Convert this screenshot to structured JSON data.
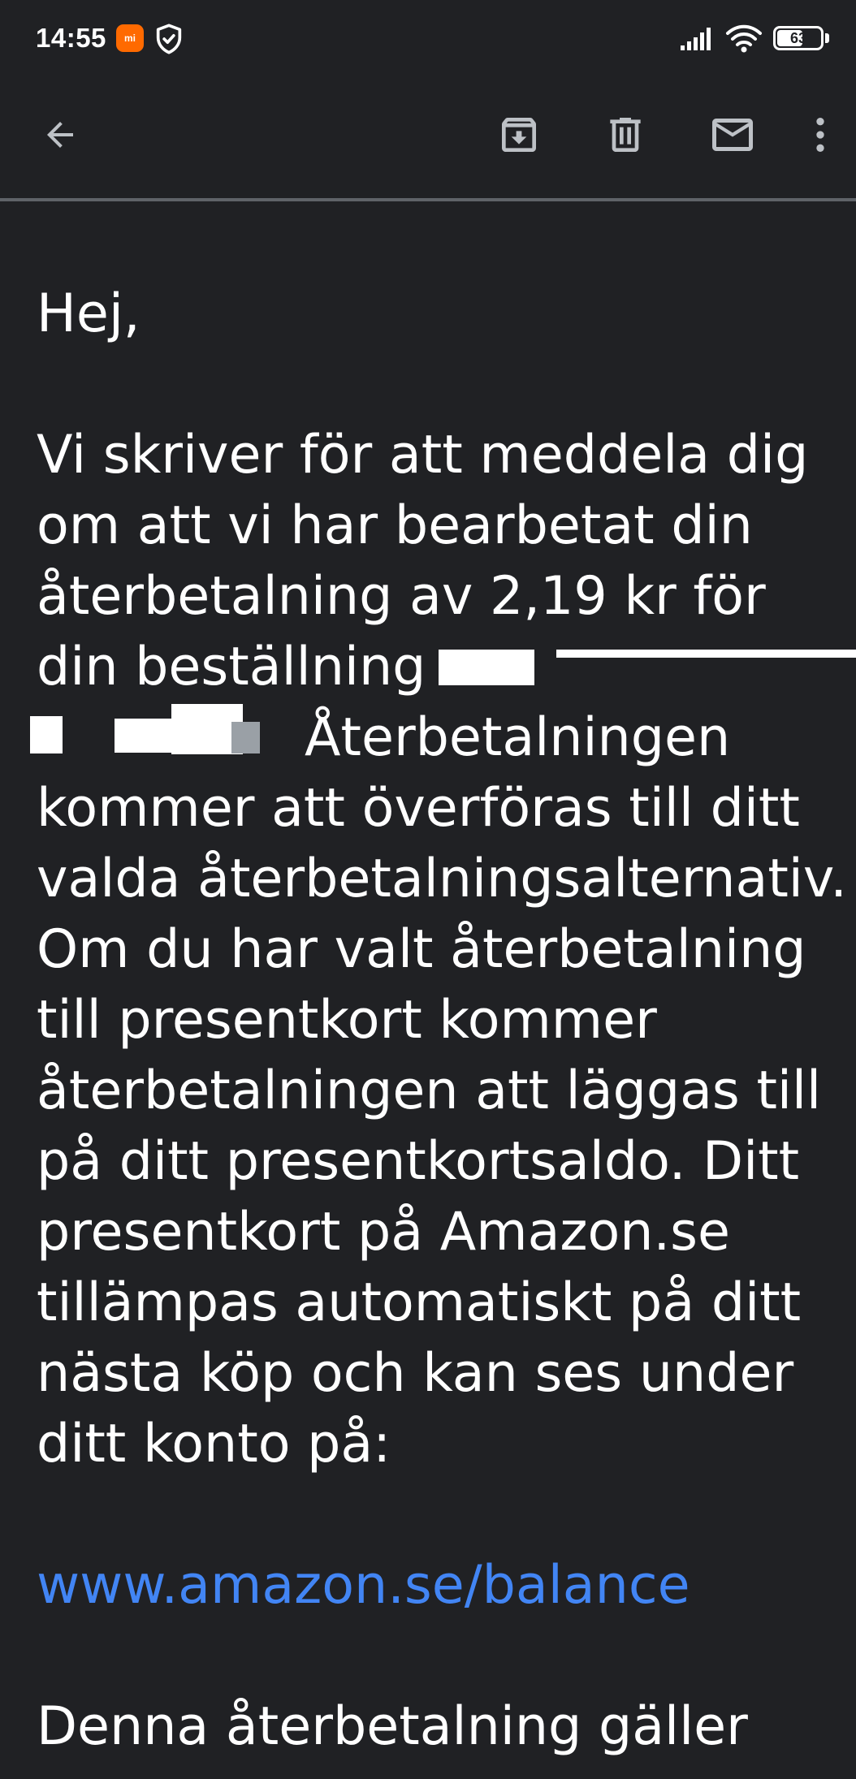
{
  "status_bar": {
    "time": "14:55",
    "mi_badge": "mi",
    "battery": "63",
    "battery_level": 0.63,
    "icons": [
      "mi-app-icon",
      "shield-check-icon",
      "signal-icon",
      "wifi-icon",
      "battery-icon"
    ]
  },
  "toolbar": {
    "icons": [
      "back-arrow-icon",
      "archive-icon",
      "delete-icon",
      "mark-unread-icon",
      "more-vert-icon"
    ]
  },
  "email": {
    "greeting": "Hej,",
    "body_lines": [
      "Vi skriver för att meddela dig",
      "om att vi har bearbetat din",
      "återbetalning av 2,19 kr för",
      "din beställning",
      "Återbetalningen",
      "kommer att överföras till ditt",
      "valda återbetalningsalternativ.",
      "Om du har valt återbetalning",
      "till presentkort kommer",
      "återbetalningen att läggas till",
      "på ditt presentkortsaldo. Ditt",
      "presentkort på Amazon.se",
      "tillämpas automatiskt på ditt",
      "nästa köp och kan ses under",
      "ditt konto på:"
    ],
    "link": "www.amazon.se/balance",
    "closing_line": "Denna återbetalning gäller",
    "link_color": "#4285f4"
  }
}
